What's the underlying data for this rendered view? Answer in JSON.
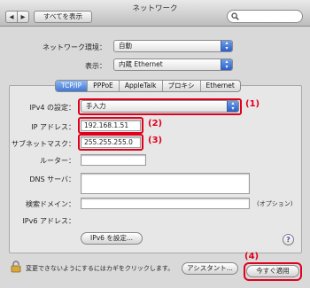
{
  "window": {
    "title": "ネットワーク"
  },
  "toolbar": {
    "back_label": "◀",
    "forward_label": "▶",
    "show_all_label": "すべてを表示",
    "search_placeholder": ""
  },
  "location": {
    "label": "ネットワーク環境：",
    "value": "自動"
  },
  "show": {
    "label": "表示：",
    "value": "内蔵 Ethernet"
  },
  "tabs": [
    "TCP/IP",
    "PPPoE",
    "AppleTalk",
    "プロキシ",
    "Ethernet"
  ],
  "tcpip": {
    "configure_label": "IPv4 の設定：",
    "configure_value": "手入力",
    "ip_label": "IP アドレス：",
    "ip_value": "192.168.1.51",
    "subnet_label": "サブネットマスク：",
    "subnet_value": "255.255.255.0",
    "router_label": "ルーター：",
    "router_value": "",
    "dns_label": "DNS サーバ：",
    "dns_value": "",
    "search_domains_label": "検索ドメイン：",
    "search_domains_value": "",
    "optional_label": "(オプション)",
    "ipv6_label": "IPv6 アドレス：",
    "ipv6_button": "IPv6 を設定..."
  },
  "annotations": [
    "(1)",
    "(2)",
    "(3)",
    "(4)"
  ],
  "help_label": "?",
  "footer": {
    "lock_text": "変更できないようにするにはカギをクリックします。",
    "assist_button": "アシスタント...",
    "apply_button": "今すぐ適用"
  },
  "colors": {
    "annotation_red": "#e0001b",
    "accent_blue": "#3f77d6"
  }
}
